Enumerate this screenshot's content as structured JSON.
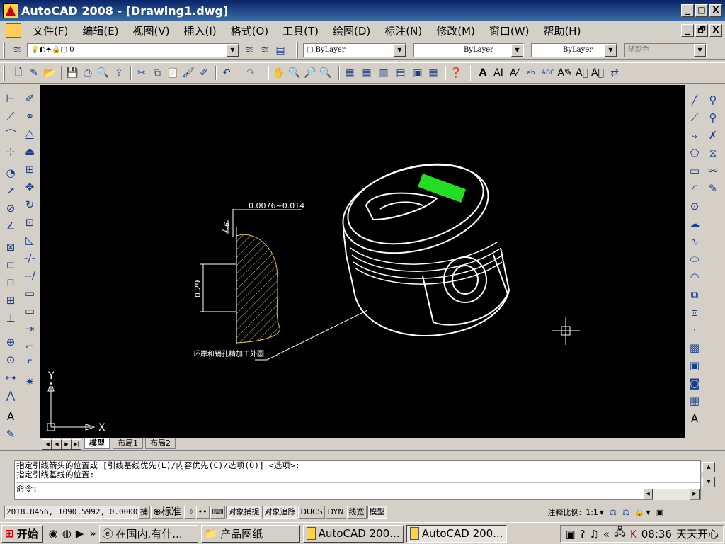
{
  "titlebar": {
    "title": "AutoCAD 2008 - [Drawing1.dwg]",
    "min": "_",
    "max": "□",
    "close": "X"
  },
  "menu": {
    "items": [
      "文件(F)",
      "编辑(E)",
      "视图(V)",
      "插入(I)",
      "格式(O)",
      "工具(T)",
      "绘图(D)",
      "标注(N)",
      "修改(M)",
      "窗口(W)",
      "帮助(H)"
    ],
    "mdi_min": "_",
    "mdi_restore": "🗗",
    "mdi_close": "X"
  },
  "layers": {
    "current_layer": "0",
    "color": "ByLayer",
    "linetype": "ByLayer",
    "lineweight": "ByLayer",
    "plotstyle": "随颜色"
  },
  "drawing": {
    "dim_top": "0.0076~0.014",
    "dim_small": "1.6",
    "dim_side": "0.29",
    "leader_text": "环岸和销孔精加工外圆",
    "ucs_x": "X",
    "ucs_y": "Y",
    "piston_label_color": "#22dd22",
    "hatch_color": "#d8c84a"
  },
  "tabs": {
    "items": [
      "模型",
      "布局1",
      "布局2"
    ],
    "active": "模型"
  },
  "command": {
    "line1": "指定引线箭头的位置或 [引线基线优先(L)/内容优先(C)/选项(O)] <选项>:",
    "line2": "指定引线基线的位置:",
    "prompt": "命令:"
  },
  "status": {
    "coords": "2018.8456, 1090.5992, 0.0000",
    "snap": "捕",
    "standard": "标准",
    "toggles": [
      "对象捕捉",
      "对象追踪",
      "DUCS",
      "DYN",
      "线宽",
      "模型"
    ],
    "scale_label": "注释比例:",
    "scale_value": "1:1"
  },
  "taskbar": {
    "start": "开始",
    "items": [
      "在国内,有什...",
      "产品图纸",
      "AutoCAD 200...",
      "AutoCAD 200..."
    ],
    "active_index": 3,
    "clock": "08:36",
    "tray_text": "天天开心"
  },
  "colors": {
    "titlebar": "#0a246a",
    "canvas": "#000000",
    "chrome": "#d4d0c8"
  }
}
